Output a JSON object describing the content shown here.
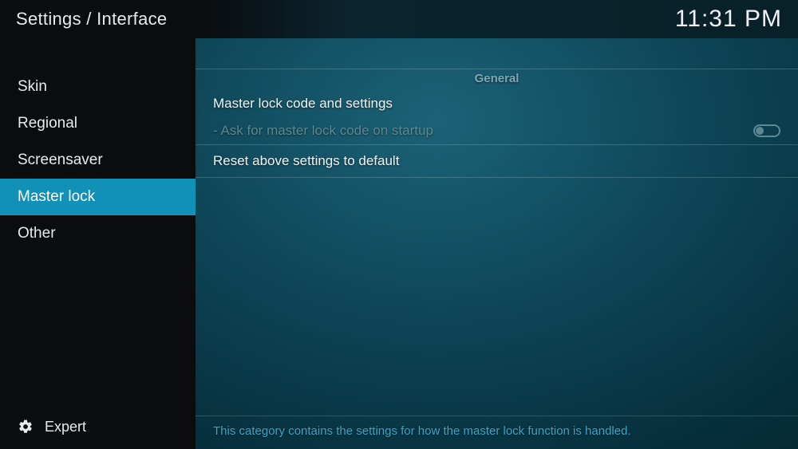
{
  "header": {
    "breadcrumb": "Settings / Interface",
    "clock": "11:31 PM"
  },
  "sidebar": {
    "items": [
      {
        "label": "Skin",
        "selected": false
      },
      {
        "label": "Regional",
        "selected": false
      },
      {
        "label": "Screensaver",
        "selected": false
      },
      {
        "label": "Master lock",
        "selected": true
      },
      {
        "label": "Other",
        "selected": false
      }
    ],
    "settings_level_label": "Expert"
  },
  "main": {
    "section_header": "General",
    "rows": [
      {
        "label": "Master lock code and settings",
        "type": "action",
        "disabled": false
      },
      {
        "label": "- Ask for master lock code on startup",
        "type": "toggle",
        "value": false,
        "disabled": true
      },
      {
        "label": "Reset above settings to default",
        "type": "action",
        "disabled": false
      }
    ],
    "description": "This category contains the settings for how the master lock function is handled."
  }
}
